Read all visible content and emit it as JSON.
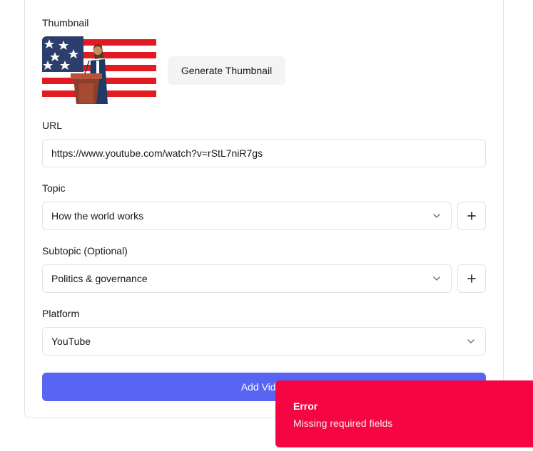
{
  "thumbnail": {
    "label": "Thumbnail",
    "generate_button": "Generate Thumbnail"
  },
  "url": {
    "label": "URL",
    "value": "https://www.youtube.com/watch?v=rStL7niR7gs"
  },
  "topic": {
    "label": "Topic",
    "value": "How the world works"
  },
  "subtopic": {
    "label": "Subtopic (Optional)",
    "value": "Politics & governance"
  },
  "platform": {
    "label": "Platform",
    "value": "YouTube"
  },
  "submit_button": "Add Video",
  "toast": {
    "title": "Error",
    "description": "Missing required fields"
  },
  "colors": {
    "primary": "#5865f2",
    "error": "#f50541",
    "border": "#e4e4e7"
  },
  "icons": [
    "chevron-down-icon",
    "plus-icon"
  ]
}
